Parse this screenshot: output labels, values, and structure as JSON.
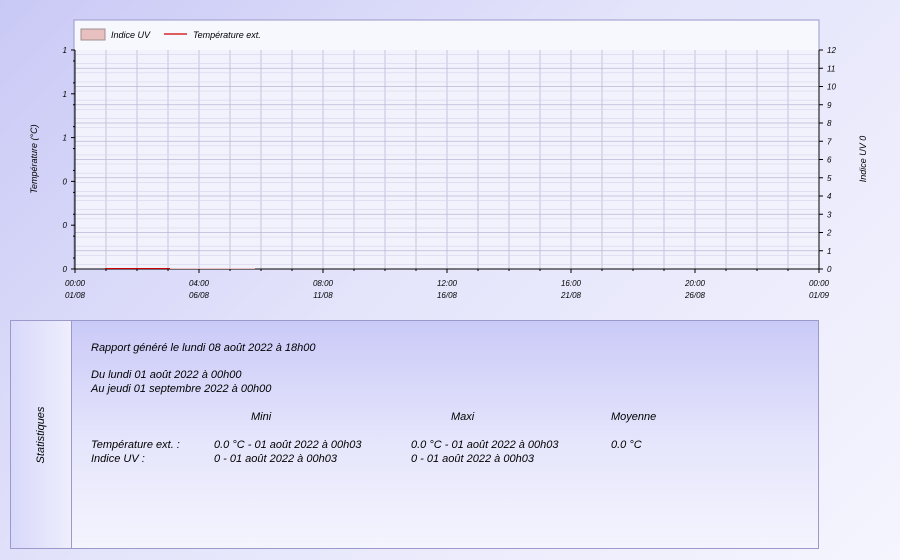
{
  "chart_data": {
    "type": "area",
    "legend": {
      "placement": "top-left",
      "uv_label": "Indice UV",
      "temp_label": "Température ext."
    },
    "y_left": {
      "label": "Température (°C)",
      "ticks": [
        "0",
        "0",
        "0",
        "1",
        "1",
        "1"
      ]
    },
    "y_right": {
      "label": "Indice UV 0",
      "ticks": [
        "0",
        "1",
        "2",
        "3",
        "4",
        "5",
        "6",
        "7",
        "8",
        "9",
        "10",
        "11",
        "12"
      ],
      "range": [
        0,
        12
      ]
    },
    "x_ticks": [
      {
        "time": "00:00",
        "date": "01/08"
      },
      {
        "time": "04:00",
        "date": "06/08"
      },
      {
        "time": "08:00",
        "date": "11/08"
      },
      {
        "time": "12:00",
        "date": "16/08"
      },
      {
        "time": "16:00",
        "date": "21/08"
      },
      {
        "time": "20:00",
        "date": "26/08"
      },
      {
        "time": "00:00",
        "date": "01/09"
      }
    ],
    "series": [
      {
        "name": "Indice UV",
        "color": "#e8c0c0",
        "values": [
          0,
          0
        ]
      },
      {
        "name": "Température ext.",
        "color": "#cc0000",
        "values": [
          0,
          0
        ]
      }
    ],
    "grid": true
  },
  "colors": {
    "plot_bg": "#f2f2fc",
    "grid": "#a8a8cc",
    "temp_line": "#cc0000"
  },
  "stats": {
    "side_label": "Statistiques",
    "generated": "Rapport généré le lundi 08 août 2022 à 18h00",
    "from": "Du lundi 01 août 2022 à 00h00",
    "to": "Au jeudi 01 septembre 2022 à 00h00",
    "col_min": "Mini",
    "col_max": "Maxi",
    "col_avg": "Moyenne",
    "rows": [
      {
        "label": "Température ext. :",
        "min": "0.0 °C - 01 août 2022 à 00h03",
        "max": "0.0 °C - 01 août 2022 à 00h03",
        "avg": "0.0 °C"
      },
      {
        "label": "Indice UV :",
        "min": "0 - 01 août 2022 à 00h03",
        "max": "0 - 01 août 2022 à 00h03",
        "avg": ""
      }
    ]
  }
}
